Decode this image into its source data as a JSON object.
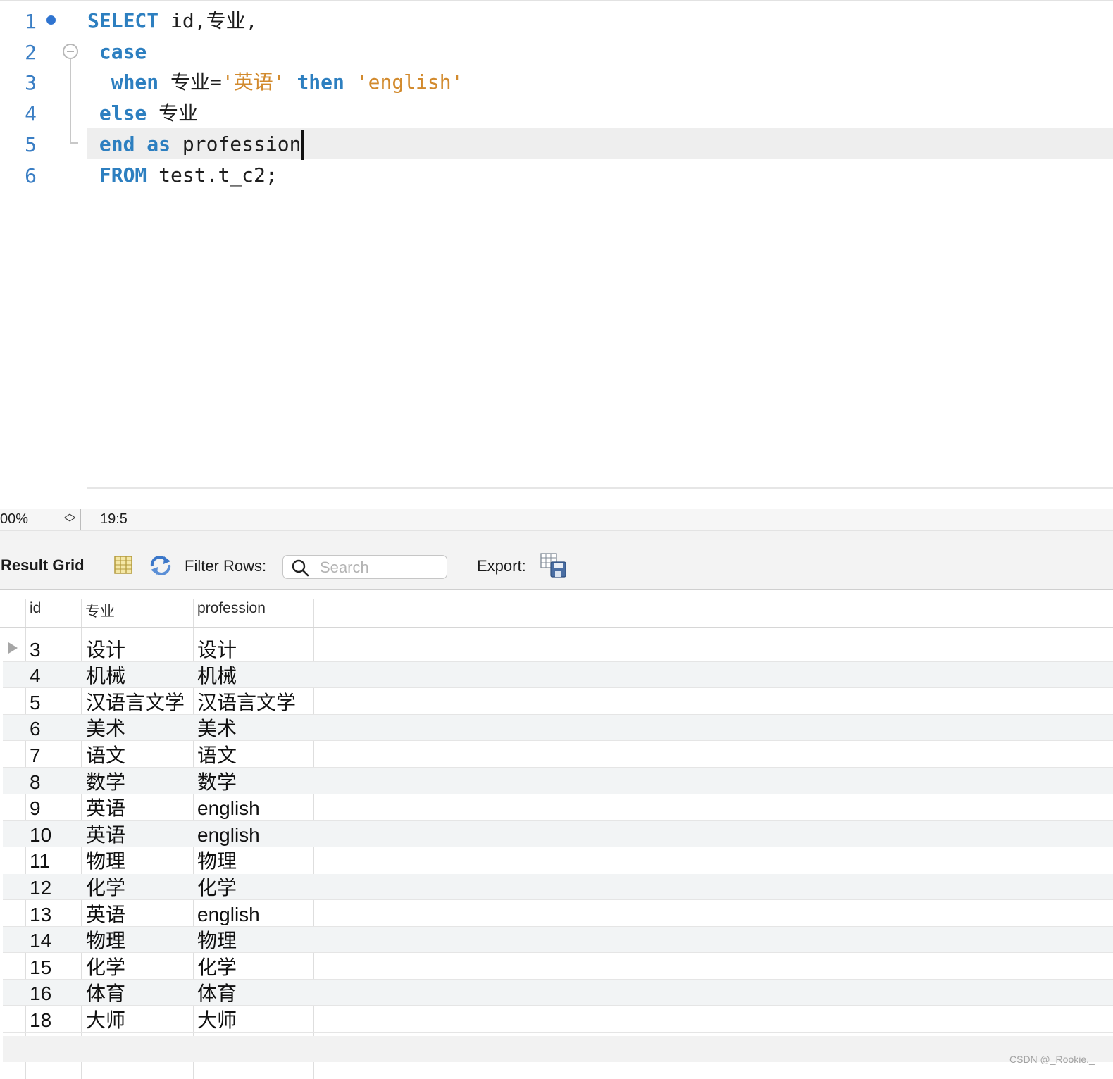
{
  "editor": {
    "line_numbers": [
      "1",
      "2",
      "3",
      "4",
      "5",
      "6"
    ],
    "lines": [
      [
        {
          "t": "SELECT",
          "c": "kw"
        },
        {
          "t": " id,专业,",
          "c": ""
        }
      ],
      [
        {
          "t": " case",
          "c": "kw"
        }
      ],
      [
        {
          "t": "  when",
          "c": "kw"
        },
        {
          "t": " 专业=",
          "c": ""
        },
        {
          "t": "'英语'",
          "c": "str"
        },
        {
          "t": " ",
          "c": ""
        },
        {
          "t": "then",
          "c": "kw"
        },
        {
          "t": " ",
          "c": ""
        },
        {
          "t": "'english'",
          "c": "str"
        }
      ],
      [
        {
          "t": " else",
          "c": "kw"
        },
        {
          "t": " 专业",
          "c": ""
        }
      ],
      [
        {
          "t": " end",
          "c": "kw"
        },
        {
          "t": " ",
          "c": ""
        },
        {
          "t": "as",
          "c": "kw"
        },
        {
          "t": " profession",
          "c": ""
        }
      ],
      [
        {
          "t": " FROM",
          "c": "kw"
        },
        {
          "t": " test.t_c2;",
          "c": ""
        }
      ]
    ],
    "caret_line": 5
  },
  "statusbar": {
    "zoom": "00%",
    "cursor_position": "19:5"
  },
  "result_toolbar": {
    "title": "Result Grid",
    "grid_icon": "grid-columns-icon",
    "refresh_icon": "refresh-icon",
    "filter_label": "Filter Rows:",
    "search_placeholder": "Search",
    "export_label": "Export:",
    "export_icon": "export-spreadsheet-icon"
  },
  "grid": {
    "columns": [
      "id",
      "专业",
      "profession"
    ],
    "rows": [
      [
        "3",
        "设计",
        "设计"
      ],
      [
        "4",
        "机械",
        "机械"
      ],
      [
        "5",
        "汉语言文学",
        "汉语言文学"
      ],
      [
        "6",
        "美术",
        "美术"
      ],
      [
        "7",
        "语文",
        "语文"
      ],
      [
        "8",
        "数学",
        "数学"
      ],
      [
        "9",
        "英语",
        "english"
      ],
      [
        "10",
        "英语",
        "english"
      ],
      [
        "11",
        "物理",
        "物理"
      ],
      [
        "12",
        "化学",
        "化学"
      ],
      [
        "13",
        "英语",
        "english"
      ],
      [
        "14",
        "物理",
        "物理"
      ],
      [
        "15",
        "化学",
        "化学"
      ],
      [
        "16",
        "体育",
        "体育"
      ],
      [
        "18",
        "大师",
        "大师"
      ]
    ],
    "selected_row_marker_index": 0
  },
  "watermark": "CSDN @_Rookie._",
  "colors": {
    "keyword": "#2d7fc0",
    "string": "#d28a2d",
    "line_number": "#3a7ec4"
  }
}
